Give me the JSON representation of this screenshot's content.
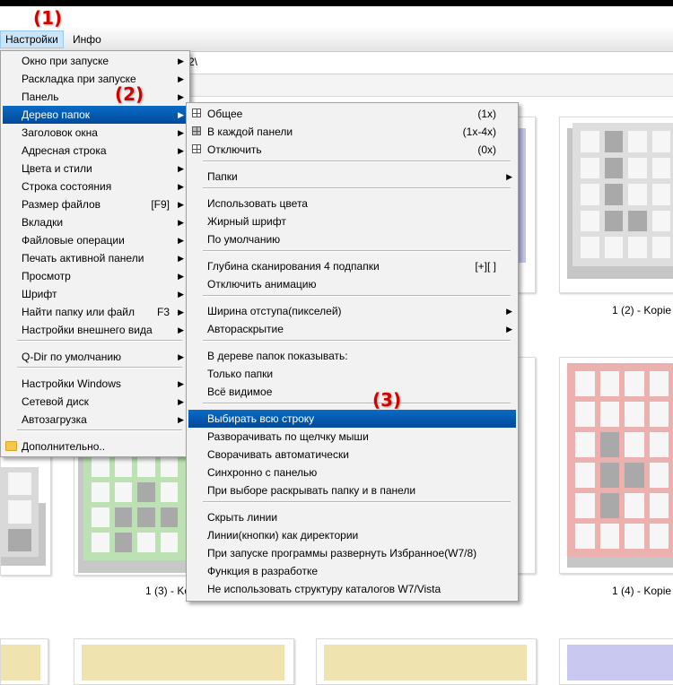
{
  "menubar": {
    "settings": "Настройки",
    "info": "Инфо"
  },
  "address": {
    "path_fragment": "2\\"
  },
  "annotations": {
    "a1": "(1)",
    "a2": "(2)",
    "a3": "(3)"
  },
  "main_menu": {
    "items": [
      {
        "label": "Окно при запуске",
        "shortcut": "",
        "submenu": true
      },
      {
        "label": "Раскладка при запуске",
        "shortcut": "",
        "submenu": true
      },
      {
        "label": "Панель",
        "shortcut": "",
        "submenu": true
      },
      {
        "label": "Дерево папок",
        "shortcut": "",
        "submenu": true,
        "highlighted": true
      },
      {
        "label": "Заголовок окна",
        "shortcut": "",
        "submenu": true
      },
      {
        "label": "Адресная строка",
        "shortcut": "",
        "submenu": true
      },
      {
        "label": "Цвета и стили",
        "shortcut": "",
        "submenu": true
      },
      {
        "label": "Строка состояния",
        "shortcut": "",
        "submenu": true
      },
      {
        "label": "Размер файлов",
        "shortcut": "[F9]",
        "submenu": true
      },
      {
        "label": "Вкладки",
        "shortcut": "",
        "submenu": true
      },
      {
        "label": "Файловые операции",
        "shortcut": "",
        "submenu": true
      },
      {
        "label": "Печать активной панели",
        "shortcut": "",
        "submenu": true
      },
      {
        "label": "Просмотр",
        "shortcut": "",
        "submenu": true
      },
      {
        "label": "Шрифт",
        "shortcut": "",
        "submenu": true
      },
      {
        "label": "Найти папку или файл",
        "shortcut": "F3",
        "submenu": true
      },
      {
        "label": "Настройки внешнего вида",
        "shortcut": "",
        "submenu": true
      },
      {
        "label": "Q-Dir по умолчанию",
        "shortcut": "",
        "submenu": true
      },
      {
        "label": "Настройки Windows",
        "shortcut": "",
        "submenu": true
      },
      {
        "label": "Сетевой диск",
        "shortcut": "",
        "submenu": true
      },
      {
        "label": "Автозагрузка",
        "shortcut": "",
        "submenu": true
      },
      {
        "label": "Дополнительно..",
        "shortcut": "",
        "submenu": false
      }
    ]
  },
  "sub_menu": {
    "items": [
      {
        "label": "Общее",
        "shortcut": "(1x)"
      },
      {
        "label": "В каждой панели",
        "shortcut": "(1x-4x)"
      },
      {
        "label": "Отключить",
        "shortcut": "(0x)"
      },
      {
        "label": "Папки",
        "shortcut": ""
      },
      {
        "label": "Использовать цвета",
        "shortcut": ""
      },
      {
        "label": "Жирный шрифт",
        "shortcut": ""
      },
      {
        "label": "По умолчанию",
        "shortcut": ""
      },
      {
        "label": "Глубина сканирования 4 подпапки",
        "shortcut": "[+][ ]"
      },
      {
        "label": "Отключить анимацию",
        "shortcut": ""
      },
      {
        "label": "Ширина отступа(пикселей)",
        "shortcut": ""
      },
      {
        "label": "Автораскрытие",
        "shortcut": ""
      },
      {
        "label": "В дереве папок показывать:",
        "shortcut": ""
      },
      {
        "label": "Только папки",
        "shortcut": ""
      },
      {
        "label": "Всё видимое",
        "shortcut": ""
      },
      {
        "label": "Выбирать всю строку",
        "shortcut": ""
      },
      {
        "label": "Разворачивать по щелчку мыши",
        "shortcut": ""
      },
      {
        "label": "Сворачивать автоматически",
        "shortcut": ""
      },
      {
        "label": "Синхронно с панелью",
        "shortcut": ""
      },
      {
        "label": "При выборе раскрывать папку и в панели",
        "shortcut": ""
      },
      {
        "label": "Скрыть линии",
        "shortcut": ""
      },
      {
        "label": "Линии(кнопки) как директории",
        "shortcut": ""
      },
      {
        "label": "При запуске программы развернуть Избранное(W7/8)",
        "shortcut": ""
      },
      {
        "label": "Функция в разработке",
        "shortcut": ""
      },
      {
        "label": "Не использовать структуру каталогов W7/Vista",
        "shortcut": ""
      }
    ]
  },
  "thumbnails": {
    "cap1": "1 (2) - Kopie",
    "cap2": "1 (3) - Ko",
    "cap3": "1 (4) - Kopie"
  }
}
